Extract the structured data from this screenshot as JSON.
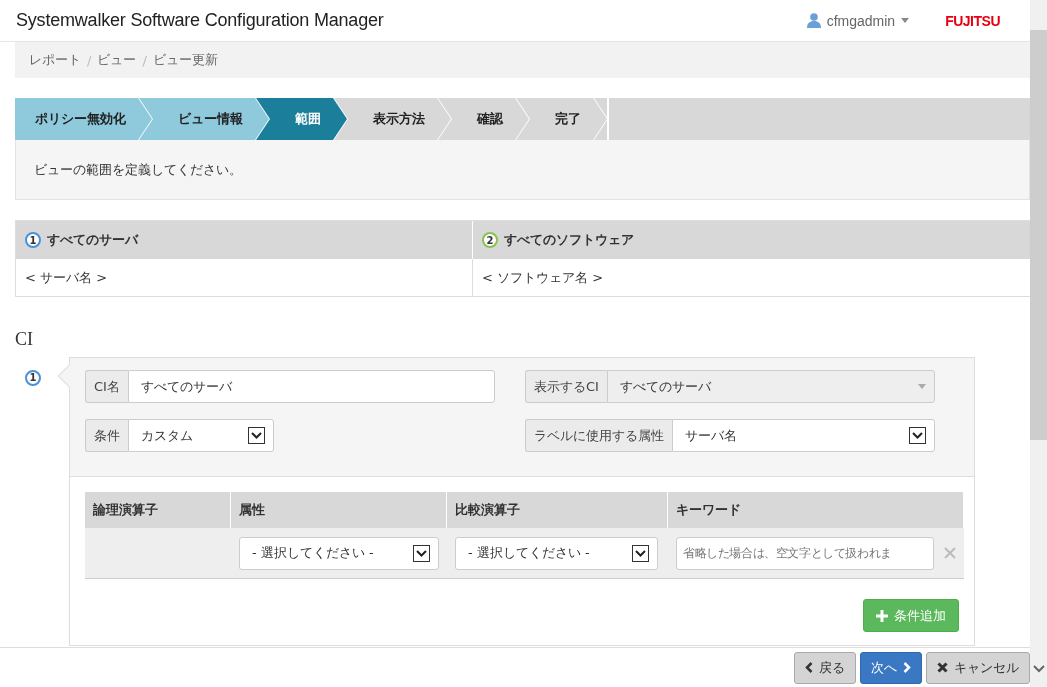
{
  "header": {
    "title": "Systemwalker Software Configuration Manager",
    "user": "cfmgadmin",
    "logo": "FUJITSU"
  },
  "breadcrumb": {
    "separator": "/",
    "items": [
      "レポート",
      "ビュー",
      "ビュー更新"
    ]
  },
  "steps": [
    {
      "label": "ポリシー無効化",
      "completed": true,
      "selected": false
    },
    {
      "label": "ビュー情報",
      "completed": true,
      "selected": false
    },
    {
      "label": "範囲",
      "completed": false,
      "selected": true
    },
    {
      "label": "表示方法",
      "completed": false,
      "selected": false
    },
    {
      "label": "確認",
      "completed": false,
      "selected": false
    },
    {
      "label": "完了",
      "completed": false,
      "selected": false
    }
  ],
  "message": "ビューの範囲を定義してください。",
  "scope_table": {
    "columns": [
      {
        "number": "1",
        "color": "#4a90d9",
        "title": "すべてのサーバ",
        "value": "< サーバ名 >"
      },
      {
        "number": "2",
        "color": "#8cc152",
        "title": "すべてのソフトウェア",
        "value": "< ソフトウェア名 >"
      }
    ]
  },
  "ci": {
    "heading": "CI",
    "items": [
      {
        "number": "1",
        "color": "#4a90d9",
        "fields": [
          {
            "kind": "input",
            "label": "CI名",
            "value": "すべてのサーバ",
            "disabled": false
          },
          {
            "kind": "dropdown",
            "label": "表示するCI",
            "value": "すべてのサーバ",
            "disabled": true
          },
          {
            "kind": "select",
            "label": "条件",
            "value": "カスタム",
            "disabled": false
          },
          {
            "kind": "select",
            "label": "ラベルに使用する属性",
            "value": "サーバ名",
            "disabled": false
          }
        ],
        "conditions": {
          "columns": [
            "論理演算子",
            "属性",
            "比較演算子",
            "キーワード"
          ],
          "rows": [
            {
              "cells": [
                {
                  "kind": "empty"
                },
                {
                  "kind": "select",
                  "value": "- 選択してください -"
                },
                {
                  "kind": "select",
                  "value": "- 選択してください -"
                },
                {
                  "kind": "input",
                  "placeholder": "省略した場合は、空文字として扱われま"
                }
              ]
            }
          ]
        },
        "add_button": "条件追加"
      }
    ]
  },
  "footer": {
    "buttons": [
      {
        "kind": "back",
        "label": "戻る"
      },
      {
        "kind": "next",
        "label": "次へ"
      },
      {
        "kind": "cancel",
        "label": "キャンセル"
      }
    ]
  }
}
